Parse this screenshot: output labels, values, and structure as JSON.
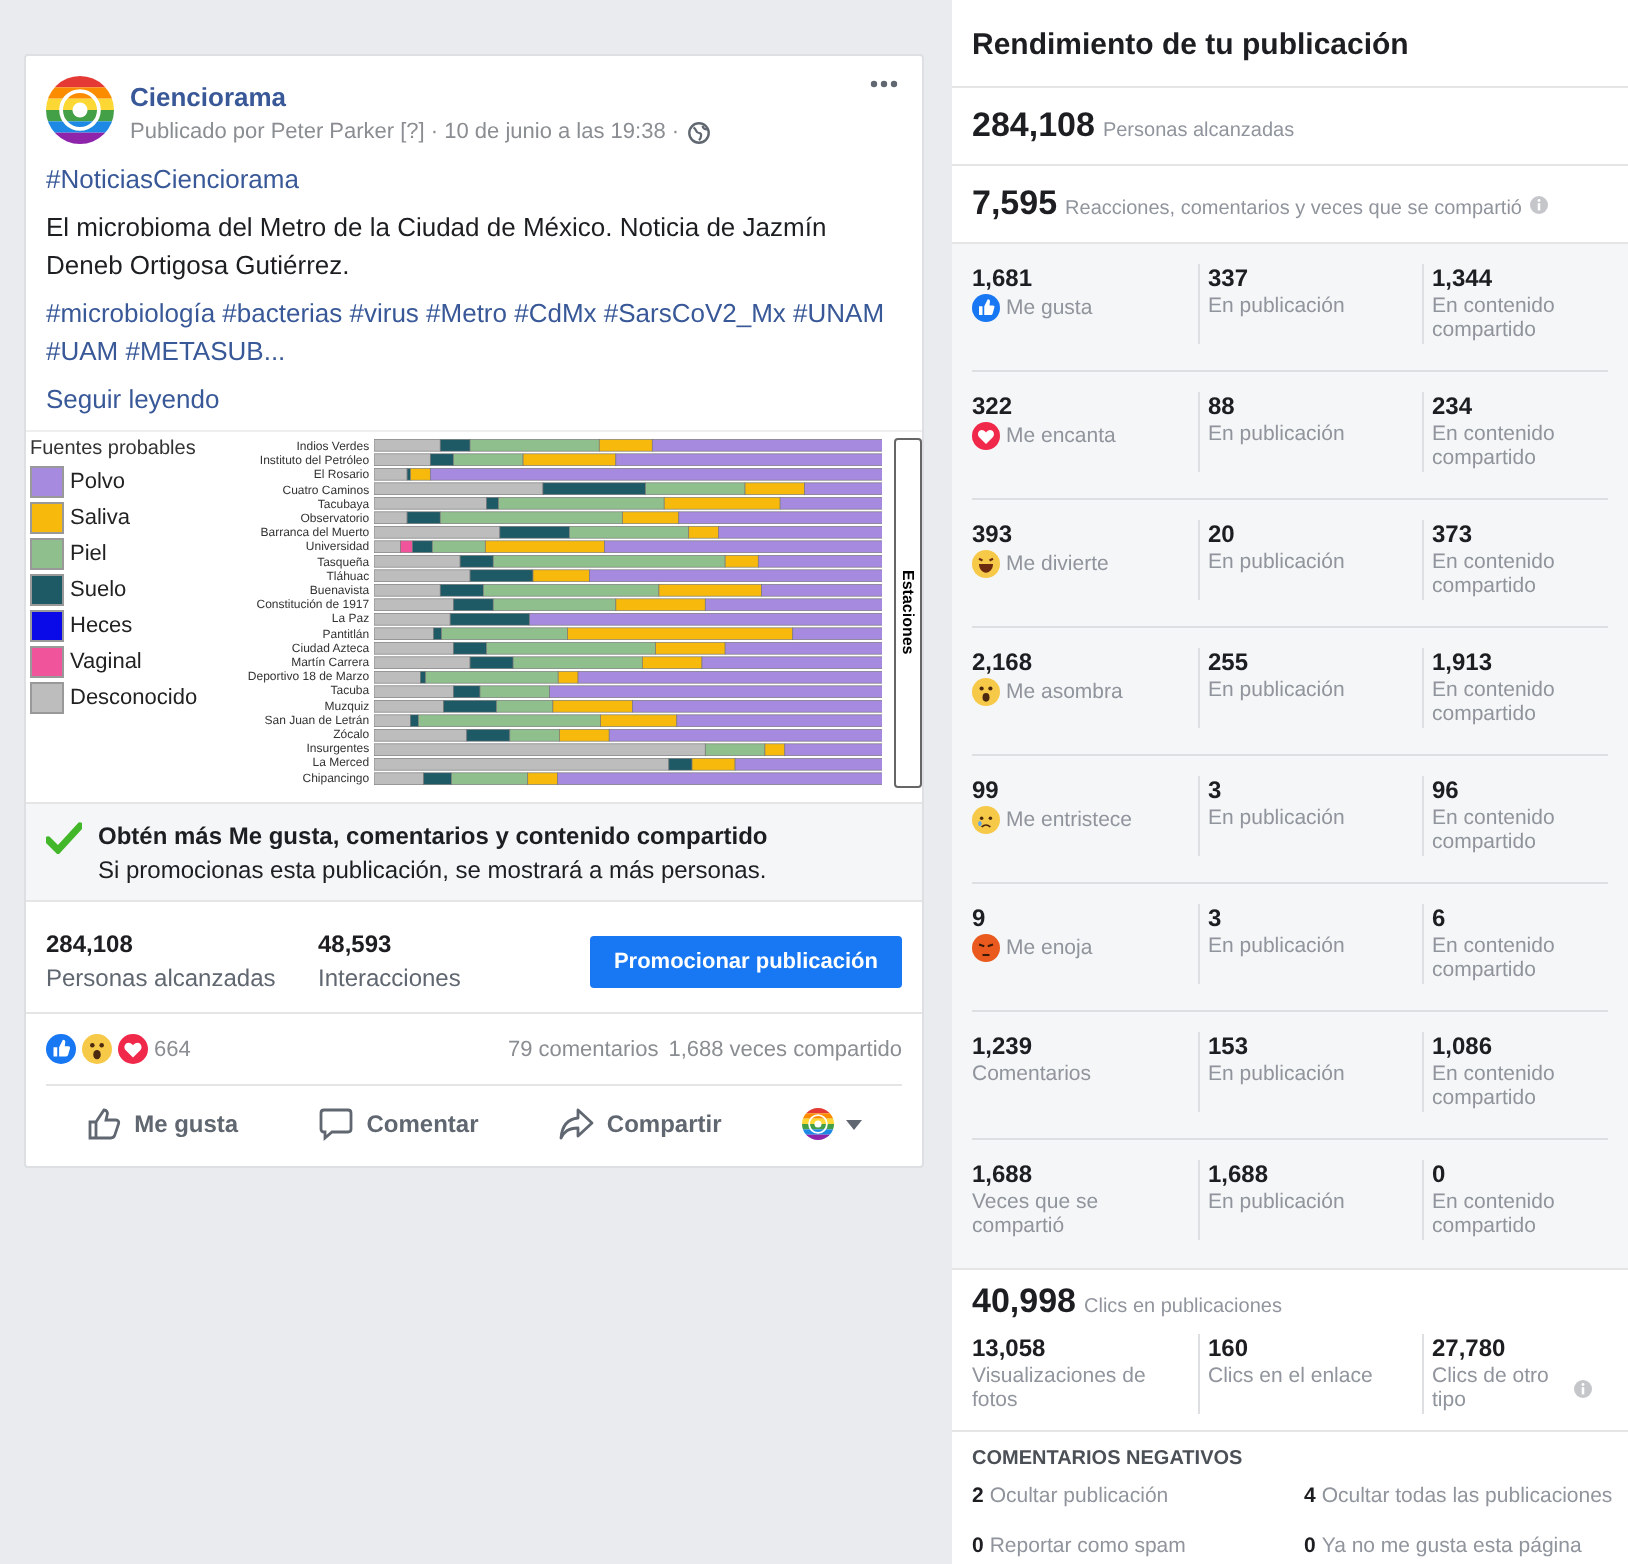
{
  "post": {
    "page_name": "Cienciorama",
    "byline": "Publicado por Peter Parker [?] · 10 de junio a las 19:38 ·",
    "hashtag": "#NoticiasCienciorama",
    "text": "El microbioma del Metro de la Ciudad de México. Noticia de Jazmín Deneb Ortigosa Gutiérrez.",
    "tags": "#microbiología #bacterias #virus #Metro #CdMx #SarsCoV2_Mx #UNAM #UAM #METASUB...",
    "read_more": "Seguir leyendo",
    "figure": {
      "legend_title": "Fuentes probables",
      "legend": [
        {
          "label": "Polvo",
          "color": "#a58ae0"
        },
        {
          "label": "Saliva",
          "color": "#f6b90c"
        },
        {
          "label": "Piel",
          "color": "#8fbf8c"
        },
        {
          "label": "Suelo",
          "color": "#1e5a66"
        },
        {
          "label": "Heces",
          "color": "#0a0ae8"
        },
        {
          "label": "Vaginal",
          "color": "#f0559c"
        },
        {
          "label": "Desconocido",
          "color": "#bdbdbd"
        }
      ],
      "stations": [
        "Indios Verdes",
        "Instituto del Petróleo",
        "El Rosario",
        "Cuatro Caminos",
        "Tacubaya",
        "Observatorio",
        "Barranca del Muerto",
        "Universidad",
        "Tasqueña",
        "Tláhuac",
        "Buenavista",
        "Constitución de 1917",
        "La Paz",
        "Pantitlán",
        "Ciudad Azteca",
        "Martín Carrera",
        "Deportivo 18 de Marzo",
        "Tacuba",
        "Muzquiz",
        "San Juan de Letrán",
        "Zócalo",
        "Insurgentes",
        "La Merced",
        "Chipancingo"
      ],
      "axis_title": "Estaciones"
    },
    "promo": {
      "title": "Obtén más Me gusta, comentarios y contenido compartido",
      "text": "Si promocionas esta publicación, se mostrará a más personas."
    },
    "stats": [
      {
        "value": "284,108",
        "label": "Personas alcanzadas"
      },
      {
        "value": "48,593",
        "label": "Interacciones"
      }
    ],
    "promote_button": "Promocionar publicación",
    "reaction_count": "664",
    "comments": "79 comentarios",
    "shares": "1,688 veces compartido",
    "actions": [
      {
        "kind": "like",
        "label": "Me gusta"
      },
      {
        "kind": "comment",
        "label": "Comentar"
      },
      {
        "kind": "share",
        "label": "Compartir"
      }
    ]
  },
  "panel": {
    "title": "Rendimiento de tu publicación",
    "reach": {
      "value": "284,108",
      "label": "Personas alcanzadas"
    },
    "engagement": {
      "value": "7,595",
      "label": "Reacciones, comentarios y veces que se compartió"
    },
    "rows": [
      {
        "kind": "like",
        "total": "1,681",
        "label": "Me gusta",
        "on_post": "337",
        "on_post_label": "En publicación",
        "on_shares": "1,344",
        "on_shares_label": "En contenido compartido"
      },
      {
        "kind": "love",
        "total": "322",
        "label": "Me encanta",
        "on_post": "88",
        "on_post_label": "En publicación",
        "on_shares": "234",
        "on_shares_label": "En contenido compartido"
      },
      {
        "kind": "haha",
        "total": "393",
        "label": "Me divierte",
        "on_post": "20",
        "on_post_label": "En publicación",
        "on_shares": "373",
        "on_shares_label": "En contenido compartido"
      },
      {
        "kind": "wow",
        "total": "2,168",
        "label": "Me asombra",
        "on_post": "255",
        "on_post_label": "En publicación",
        "on_shares": "1,913",
        "on_shares_label": "En contenido compartido"
      },
      {
        "kind": "sad",
        "total": "99",
        "label": "Me entristece",
        "on_post": "3",
        "on_post_label": "En publicación",
        "on_shares": "96",
        "on_shares_label": "En contenido compartido"
      },
      {
        "kind": "angry",
        "total": "9",
        "label": "Me enoja",
        "on_post": "3",
        "on_post_label": "En publicación",
        "on_shares": "6",
        "on_shares_label": "En contenido compartido"
      },
      {
        "kind": "plain",
        "total": "1,239",
        "label": "Comentarios",
        "on_post": "153",
        "on_post_label": "En publicación",
        "on_shares": "1,086",
        "on_shares_label": "En contenido compartido"
      },
      {
        "kind": "plain",
        "total": "1,688",
        "label": "Veces que se compartió",
        "on_post": "1,688",
        "on_post_label": "En publicación",
        "on_shares": "0",
        "on_shares_label": "En contenido compartido"
      }
    ],
    "clicks": {
      "value": "40,998",
      "label": "Clics en publicaciones",
      "items": [
        {
          "value": "13,058",
          "label": "Visualizaciones de fotos"
        },
        {
          "value": "160",
          "label": "Clics en el enlace"
        },
        {
          "value": "27,780",
          "label": "Clics de otro tipo",
          "info": true
        }
      ]
    },
    "negative": {
      "title": "COMENTARIOS NEGATIVOS",
      "items": [
        {
          "value": "2",
          "label": "Ocultar publicación"
        },
        {
          "value": "4",
          "label": "Ocultar todas las publicaciones"
        },
        {
          "value": "0",
          "label": "Reportar como spam"
        },
        {
          "value": "0",
          "label": "Ya no me gusta esta página"
        }
      ]
    }
  }
}
